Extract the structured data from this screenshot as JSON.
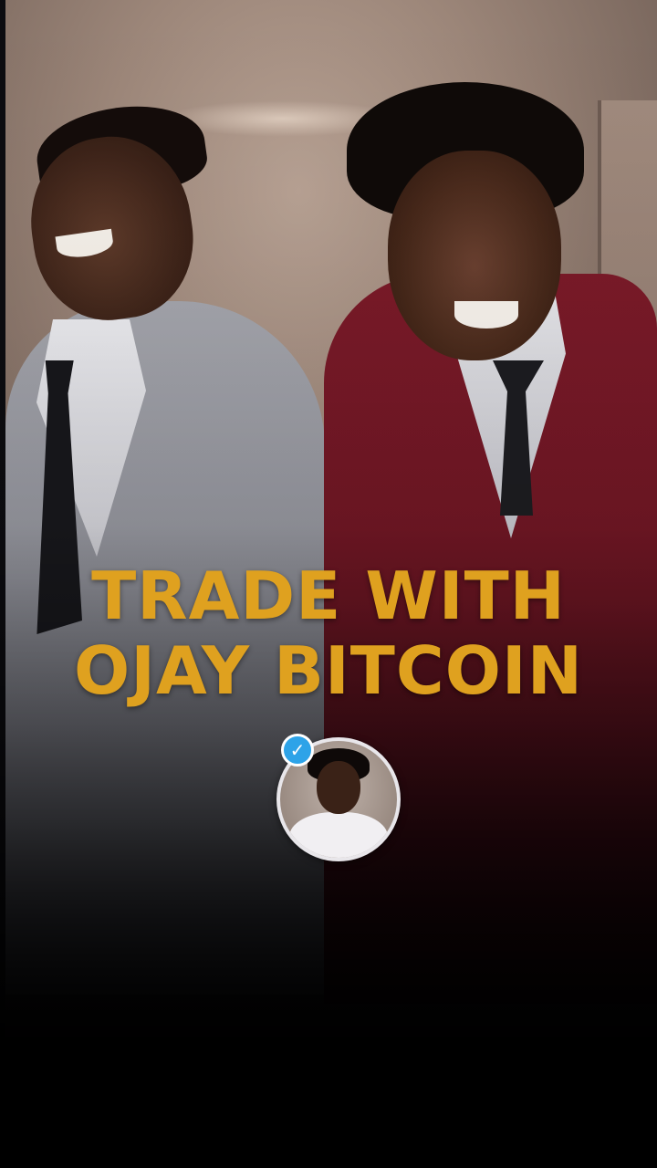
{
  "headline": {
    "line1": "TRADE WITH",
    "line2": "OJAY BITCOIN"
  },
  "profile": {
    "verified_icon": "✓"
  },
  "colors": {
    "headline": "#dfa11f",
    "verified_badge": "#2da3e8",
    "suit_left": "#9a9ba3",
    "suit_right": "#7a1a28"
  }
}
